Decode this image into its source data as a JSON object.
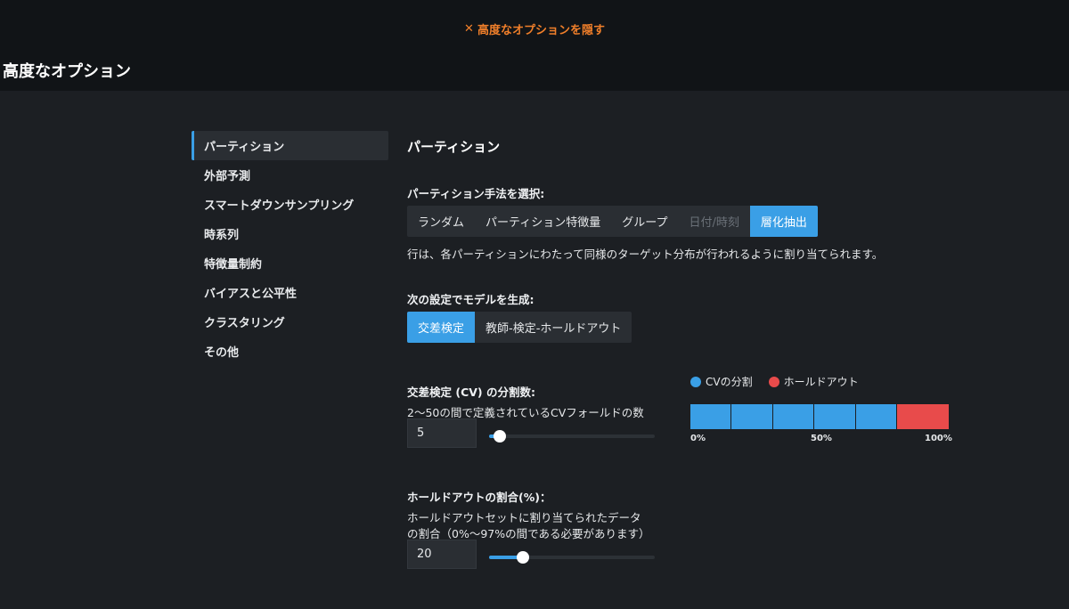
{
  "header": {
    "toggle_label": "高度なオプションを隠す",
    "page_title": "高度なオプション"
  },
  "sidebar": {
    "items": [
      {
        "label": "パーティション",
        "active": true
      },
      {
        "label": "外部予測"
      },
      {
        "label": "スマートダウンサンプリング"
      },
      {
        "label": "時系列"
      },
      {
        "label": "特徴量制約"
      },
      {
        "label": "バイアスと公平性"
      },
      {
        "label": "クラスタリング"
      },
      {
        "label": "その他"
      }
    ]
  },
  "partition": {
    "title": "パーティション",
    "method_label": "パーティション手法を選択:",
    "methods": [
      "ランダム",
      "パーティション特徴量",
      "グループ",
      "日付/時刻",
      "層化抽出"
    ],
    "selected_method": "層化抽出",
    "disabled_method": "日付/時刻",
    "method_description": "行は、各パーティションにわたって同様のターゲット分布が行われるように割り当てられます。",
    "model_label": "次の設定でモデルを生成:",
    "model_options": [
      "交差検定",
      "教師-検定-ホールドアウト"
    ],
    "selected_model_option": "交差検定",
    "cv_label": "交差検定 (CV) の分割数:",
    "cv_description": "2〜50の間で定義されているCVフォールドの数",
    "cv_value": "5",
    "cv_min": 2,
    "cv_max": 50,
    "holdout_label": "ホールドアウトの割合(%)：",
    "holdout_description_1": "ホールドアウトセットに割り当てられたデータ",
    "holdout_description_2": "の割合（0%〜97%の間である必要があります）",
    "holdout_value": "20",
    "holdout_min": 0,
    "holdout_max": 97
  },
  "split_chart": {
    "legend_cv": "CVの分割",
    "legend_holdout": "ホールドアウト",
    "axis_0": "0%",
    "axis_50": "50%",
    "axis_100": "100%",
    "cv_color": "#3a9fe6",
    "holdout_color": "#e84b4b"
  },
  "colors": {
    "accent": "#3a9fe6",
    "warning": "#f07f2a"
  }
}
